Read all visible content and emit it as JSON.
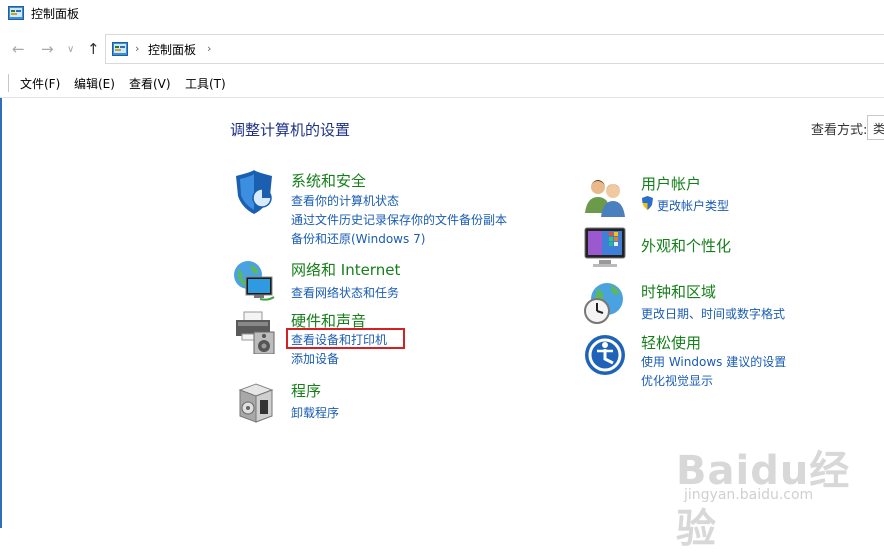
{
  "window": {
    "title": "控制面板"
  },
  "nav": {
    "back": "←",
    "forward": "→",
    "down": "∨",
    "up": "↑"
  },
  "address": {
    "separator": "›",
    "path": "控制面板",
    "separator_end": "›"
  },
  "menu": {
    "items": [
      "文件(F)",
      "编辑(E)",
      "查看(V)",
      "工具(T)"
    ]
  },
  "main": {
    "title": "调整计算机的设置",
    "view_by_label": "查看方式:",
    "view_by_value": "类"
  },
  "categories": {
    "system_security": {
      "title": "系统和安全",
      "links": [
        "查看你的计算机状态",
        "通过文件历史记录保存你的文件备份副本",
        "备份和还原(Windows 7)"
      ]
    },
    "network": {
      "title": "网络和 Internet",
      "links": [
        "查看网络状态和任务"
      ]
    },
    "hardware_sound": {
      "title": "硬件和声音",
      "links": [
        "查看设备和打印机",
        "添加设备"
      ]
    },
    "programs": {
      "title": "程序",
      "links": [
        "卸载程序"
      ]
    },
    "user_accounts": {
      "title": "用户帐户",
      "links": [
        "更改帐户类型"
      ]
    },
    "appearance": {
      "title": "外观和个性化",
      "links": []
    },
    "clock_region": {
      "title": "时钟和区域",
      "links": [
        "更改日期、时间或数字格式"
      ]
    },
    "ease_access": {
      "title": "轻松使用",
      "links": [
        "使用 Windows 建议的设置",
        "优化视觉显示"
      ]
    }
  },
  "watermark": {
    "logo": "Baidu经验",
    "url": "jingyan.baidu.com"
  },
  "colors": {
    "category_title": "#157f1a",
    "link": "#1a5cb4",
    "page_title": "#1e3287",
    "highlight": "#d42020"
  },
  "icons": {
    "window": "control-panel-icon",
    "system_security": "shield-icon",
    "network": "globe-network-icon",
    "hardware_sound": "printer-speaker-icon",
    "programs": "program-box-icon",
    "user_accounts": "users-icon",
    "appearance": "monitor-palette-icon",
    "clock_region": "clock-globe-icon",
    "ease_access": "accessibility-icon"
  }
}
